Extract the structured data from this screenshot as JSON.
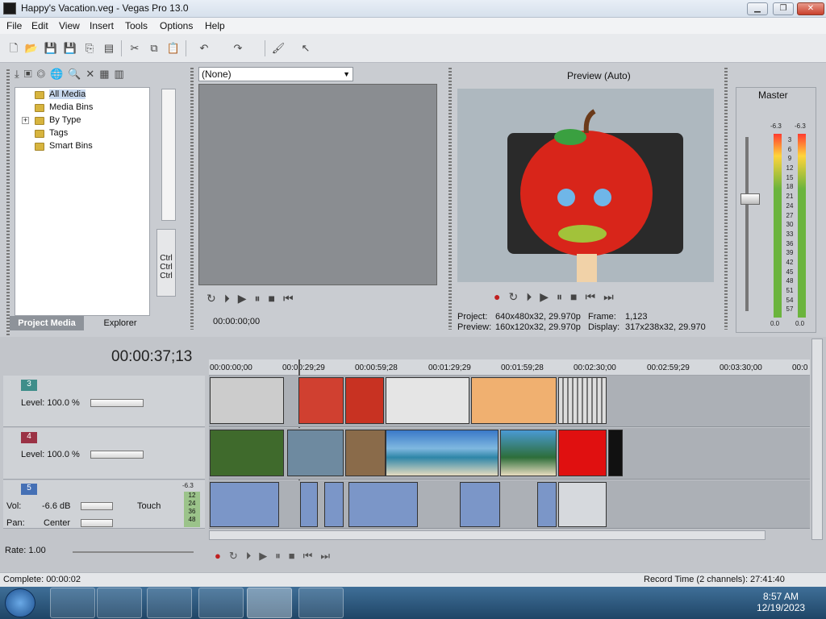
{
  "window": {
    "title": "Happy's Vacation.veg - Vegas Pro 13.0"
  },
  "menu": [
    "File",
    "Edit",
    "View",
    "Insert",
    "Tools",
    "Options",
    "Help"
  ],
  "media": {
    "tree": [
      "All Media",
      "Media Bins",
      "By Type",
      "Tags",
      "Smart Bins"
    ],
    "tabs": [
      "Project Media",
      "Explorer"
    ],
    "ctrl": [
      "Ctrl",
      "Ctrl",
      "Ctrl"
    ]
  },
  "trimmer": {
    "source": "(None)",
    "timecode": "00:00:00;00"
  },
  "preview": {
    "mode": "Preview (Auto)",
    "project_label": "Project:",
    "project": "640x480x32, 29.970p",
    "frame_label": "Frame:",
    "frame": "1,123",
    "preview_label": "Preview:",
    "preview_val": "160x120x32, 29.970p",
    "display_label": "Display:",
    "display": "317x238x32, 29.970"
  },
  "master": {
    "label": "Master",
    "peak_left": "-6.3",
    "peak_right": "-6.3",
    "scale": [
      "3",
      "6",
      "9",
      "12",
      "15",
      "18",
      "21",
      "24",
      "27",
      "30",
      "33",
      "36",
      "39",
      "42",
      "45",
      "48",
      "51",
      "54",
      "57"
    ],
    "bottom_left": "0.0",
    "bottom_right": "0.0"
  },
  "timeline": {
    "timecode": "00:00:37;13",
    "ruler": [
      "00:00:00;00",
      "00:00:29;29",
      "00:00:59;28",
      "00:01:29;29",
      "00:01:59;28",
      "00:02:30;00",
      "00:02:59;29",
      "00:03:30;00",
      "00:0"
    ],
    "tracks": [
      {
        "num": "3",
        "level": "Level: 100.0 %"
      },
      {
        "num": "4",
        "level": "Level: 100.0 %"
      },
      {
        "num": "5",
        "vol_label": "Vol:",
        "vol": "-6.6 dB",
        "pan_label": "Pan:",
        "pan": "Center",
        "touch": "Touch",
        "peak": "-6.3",
        "meter": [
          "12",
          "24",
          "36",
          "48"
        ]
      }
    ],
    "rate": "Rate: 1.00"
  },
  "status": {
    "left": "Complete: 00:00:02",
    "right": "Record Time (2 channels): 27:41:40"
  },
  "clock": {
    "time": "8:57 AM",
    "date": "12/19/2023"
  },
  "colors": {
    "track3": "#3f8e8a",
    "track4": "#9b3245",
    "track5": "#4570b5",
    "accent": "#3a6ea5"
  }
}
